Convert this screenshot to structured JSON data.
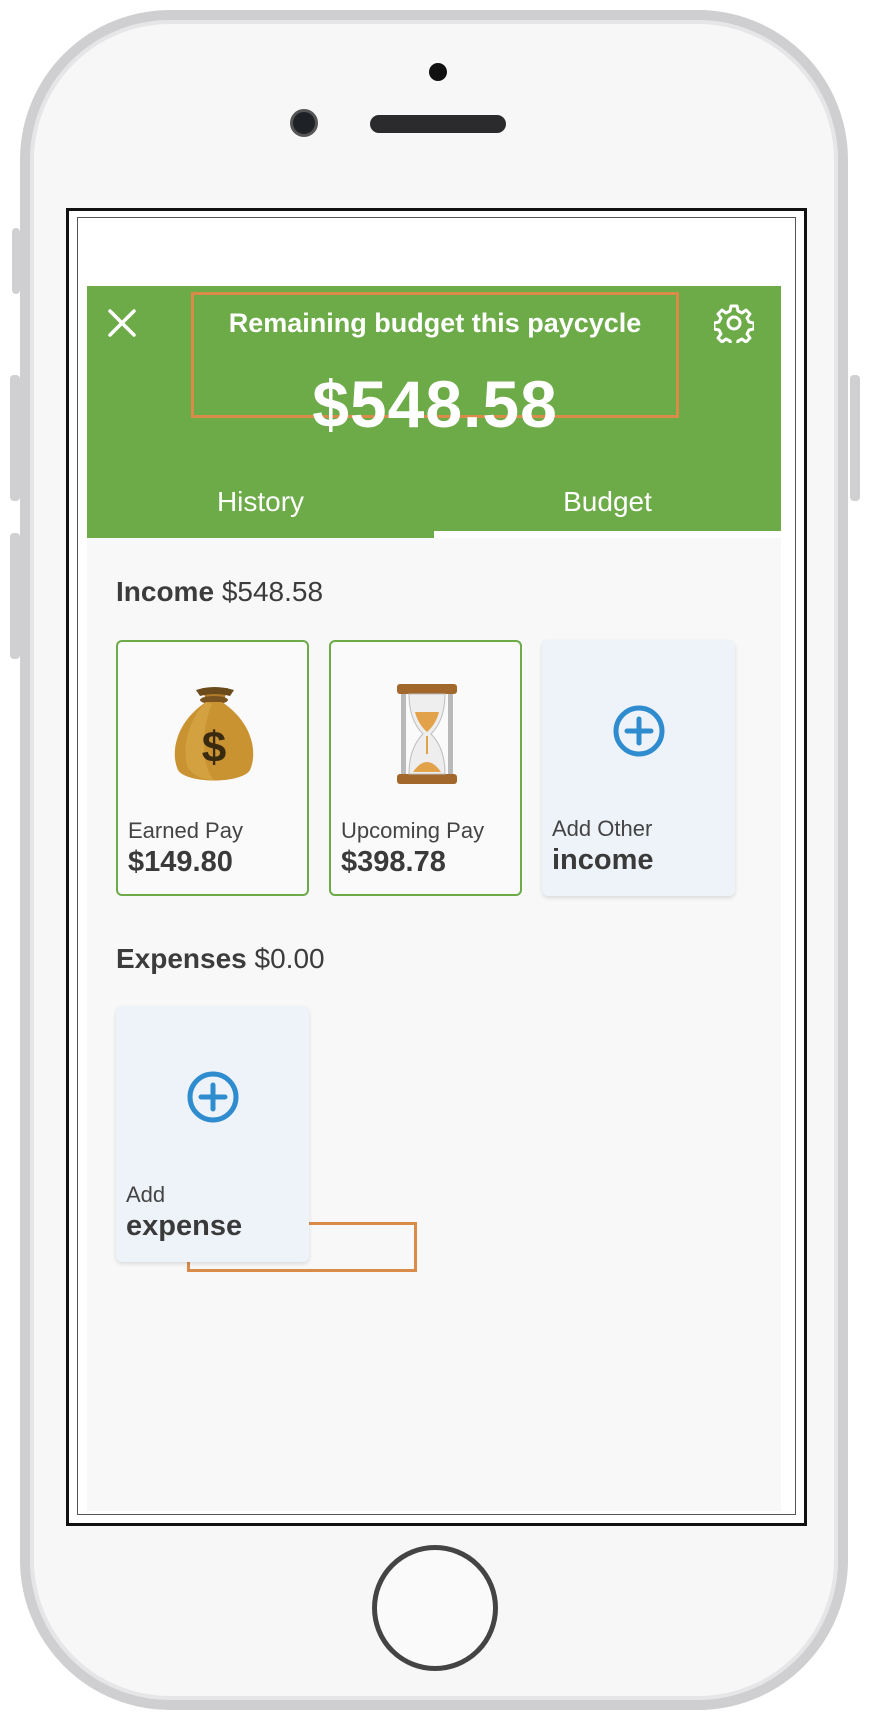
{
  "header": {
    "title": "Remaining budget this paycycle",
    "amount": "$548.58",
    "tabs": [
      "History",
      "Budget"
    ],
    "active_tab": "Budget",
    "color": "#6daa48"
  },
  "income": {
    "label": "Income",
    "total": "$548.58",
    "cards": [
      {
        "icon": "money-bag-icon",
        "label": "Earned Pay",
        "value": "$149.80"
      },
      {
        "icon": "hourglass-icon",
        "label": "Upcoming Pay",
        "value": "$398.78"
      },
      {
        "icon": "plus-circle-icon",
        "label": "Add Other",
        "value": "income"
      }
    ]
  },
  "expenses": {
    "label": "Expenses",
    "total": "$0.00",
    "cards": [
      {
        "icon": "plus-circle-icon",
        "label": "Add",
        "value": "expense"
      }
    ]
  },
  "colors": {
    "highlight": "#d98c4a",
    "accent_blue": "#2f8ccf"
  }
}
